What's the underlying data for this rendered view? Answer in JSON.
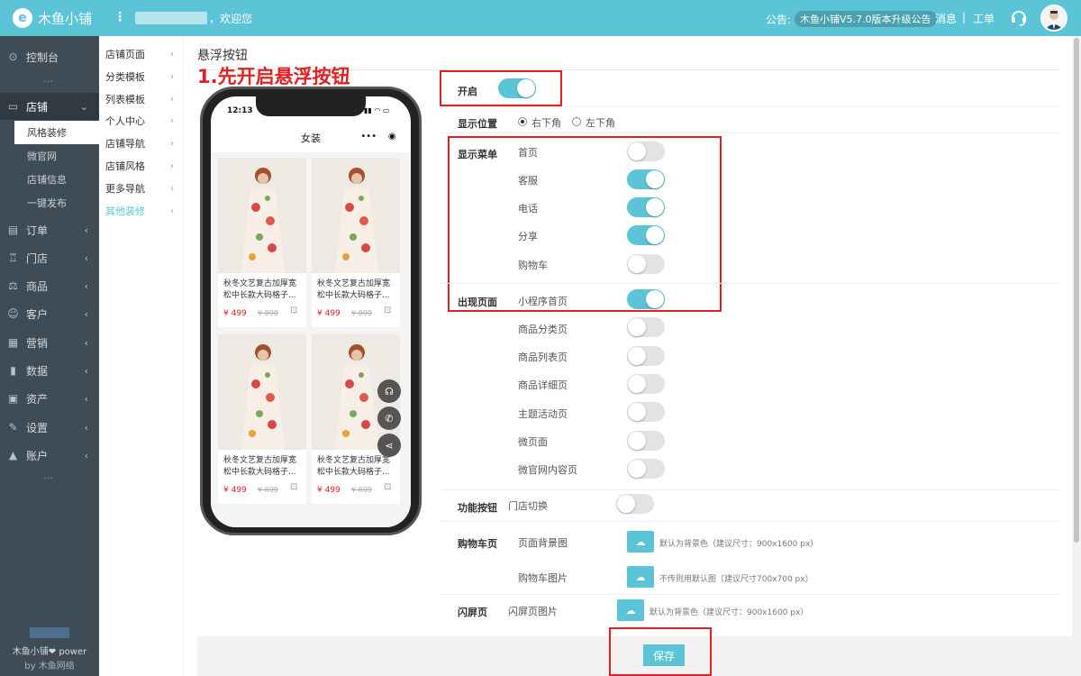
{
  "header": {
    "logo_text": "木鱼小铺",
    "menu_glyph": "⋮",
    "welcome": "，欢迎您",
    "notice_label": "公告:",
    "notice_text": "木鱼小铺V5.7.0版本升级公告",
    "messages": "消息",
    "separator": "|",
    "tickets": "工单"
  },
  "sidebar": {
    "items": [
      {
        "label": "控制台",
        "icon": "⊙"
      },
      {
        "label": "店铺",
        "icon": "▭"
      },
      {
        "label": "订单",
        "icon": "▤"
      },
      {
        "label": "门店",
        "icon": "♖"
      },
      {
        "label": "商品",
        "icon": "⚖"
      },
      {
        "label": "客户",
        "icon": "☺"
      },
      {
        "label": "营销",
        "icon": "▦"
      },
      {
        "label": "数据",
        "icon": "▮"
      },
      {
        "label": "资产",
        "icon": "▣"
      },
      {
        "label": "设置",
        "icon": "✎"
      },
      {
        "label": "账户",
        "icon": "▲"
      }
    ],
    "sub_items": [
      "风格装修",
      "微官网",
      "店铺信息",
      "一键发布"
    ],
    "dots": "···",
    "power_line1": "木鱼小铺❤ power",
    "power_line2": "by 木鱼网络"
  },
  "submenu": {
    "items": [
      "店铺页面",
      "分类模板",
      "列表模板",
      "个人中心",
      "店铺导航",
      "店铺风格",
      "更多导航",
      "其他装修"
    ]
  },
  "page": {
    "title": "悬浮按钮",
    "caption": "1.先开启悬浮按钮"
  },
  "phone": {
    "time": "12:13",
    "status": "▮▮ ◠ ▭",
    "title": "女装",
    "capsule_dots": "•••",
    "capsule_circle": "◉",
    "products": [
      {
        "desc": "秋冬文艺复古加厚宽松中长款大码格子...",
        "price": "¥ 499",
        "oprice": "¥ 899"
      },
      {
        "desc": "秋冬文艺复古加厚宽松中长款大码格子...",
        "price": "¥ 499",
        "oprice": "¥ 899"
      },
      {
        "desc": "秋冬文艺复古加厚宽松中长款大码格子...",
        "price": "¥ 499",
        "oprice": "¥ 899"
      },
      {
        "desc": "秋冬文艺复古加厚宽松中长款大码格子...",
        "price": "¥ 499",
        "oprice": "¥ 899"
      }
    ],
    "cart_glyph": "🛒",
    "float_icons": [
      "☊",
      "✆",
      "⋖"
    ]
  },
  "form": {
    "enable_label": "开启",
    "enable_on": true,
    "position_label": "显示位置",
    "position_options": [
      "右下角",
      "左下角"
    ],
    "position_selected": "右下角",
    "menu_label": "显示菜单",
    "menu_items": [
      {
        "label": "首页",
        "on": false
      },
      {
        "label": "客服",
        "on": true
      },
      {
        "label": "电话",
        "on": true
      },
      {
        "label": "分享",
        "on": true
      },
      {
        "label": "购物车",
        "on": false
      }
    ],
    "pages_label": "出现页面",
    "pages_items": [
      {
        "label": "小程序首页",
        "on": true
      },
      {
        "label": "商品分类页",
        "on": false
      },
      {
        "label": "商品列表页",
        "on": false
      },
      {
        "label": "商品详细页",
        "on": false
      },
      {
        "label": "主题活动页",
        "on": false
      },
      {
        "label": "微页面",
        "on": false
      },
      {
        "label": "微官网内容页",
        "on": false
      }
    ],
    "func_label": "功能按钮",
    "func_item": {
      "label": "门店切换",
      "on": false
    },
    "cart_page_label": "购物车页",
    "cart_bg_label": "页面背景图",
    "cart_bg_hint": "默认为背景色（建议尺寸：900x1600 px）",
    "cart_img_label": "购物车图片",
    "cart_img_hint": "不传则用默认图（建议尺寸700x700 px）",
    "splash_label": "闪屏页",
    "splash_img_label": "闪屏页图片",
    "splash_hint": "默认为背景色（建议尺寸：900x1600 px）",
    "upload_glyph": "☁",
    "save_label": "保存"
  },
  "colors": {
    "accent": "#5bc4d6",
    "annotation": "#e02121",
    "sidebar": "#3f4b55"
  }
}
